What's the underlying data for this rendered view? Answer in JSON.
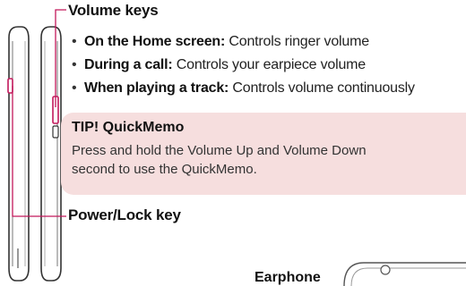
{
  "volume_keys": {
    "heading": "Volume keys",
    "items": [
      {
        "label": "On the Home screen:",
        "text": " Controls ringer volume"
      },
      {
        "label": "During a call:",
        "text": " Controls your earpiece volume"
      },
      {
        "label": "When playing a track:",
        "text": " Controls volume continuously"
      }
    ]
  },
  "tip": {
    "title": "TIP! QuickMemo",
    "body_line1": "Press and hold the Volume Up and Volume Down",
    "body_line2": "second to use the QuickMemo."
  },
  "power_lock": {
    "label": "Power/Lock key"
  },
  "earphone": {
    "label": "Earphone"
  },
  "colors": {
    "callout_line": "#c2185b",
    "tip_background": "#f6dede",
    "phone_outline": "#333333"
  }
}
